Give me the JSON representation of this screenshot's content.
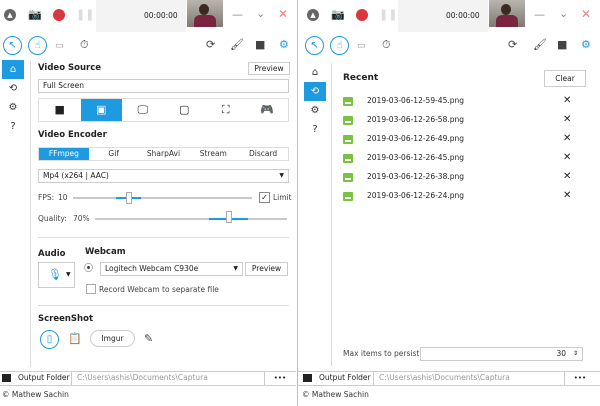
{
  "timer": "00:00:00",
  "colors": {
    "accent": "#1e9ae0",
    "record": "#d9363e",
    "image_icon": "#7cc242"
  },
  "left": {
    "video_source": {
      "title": "Video Source",
      "preview": "Preview",
      "value": "Full Screen",
      "active_index": 1
    },
    "video_encoder": {
      "title": "Video Encoder",
      "tabs": [
        "FFmpeg",
        "Gif",
        "SharpAvi",
        "Stream",
        "Discard"
      ],
      "active_tab": "FFmpeg",
      "format": "Mp4 (x264 | AAC)"
    },
    "fps": {
      "label": "FPS:",
      "value": "10",
      "limit_label": "Limit",
      "limit_checked": true
    },
    "quality": {
      "label": "Quality:",
      "value": "70%"
    },
    "audio": {
      "title": "Audio"
    },
    "webcam": {
      "title": "Webcam",
      "device": "Logitech Webcam C930e",
      "preview": "Preview",
      "separate_label": "Record Webcam to separate file",
      "separate_checked": false
    },
    "screenshot": {
      "title": "ScreenShot",
      "imgur": "Imgur"
    }
  },
  "right": {
    "title": "Recent",
    "clear": "Clear",
    "items": [
      "2019-03-06-12-59-45.png",
      "2019-03-06-12-26-58.png",
      "2019-03-06-12-26-49.png",
      "2019-03-06-12-26-45.png",
      "2019-03-06-12-26-38.png",
      "2019-03-06-12-26-24.png"
    ],
    "max_label": "Max items to persist:",
    "max_value": "30"
  },
  "footer": {
    "output_label": "Output Folder",
    "path": "C:\\Users\\ashis\\Documents\\Captura",
    "more": "•••",
    "copyright": "© Mathew Sachin"
  }
}
